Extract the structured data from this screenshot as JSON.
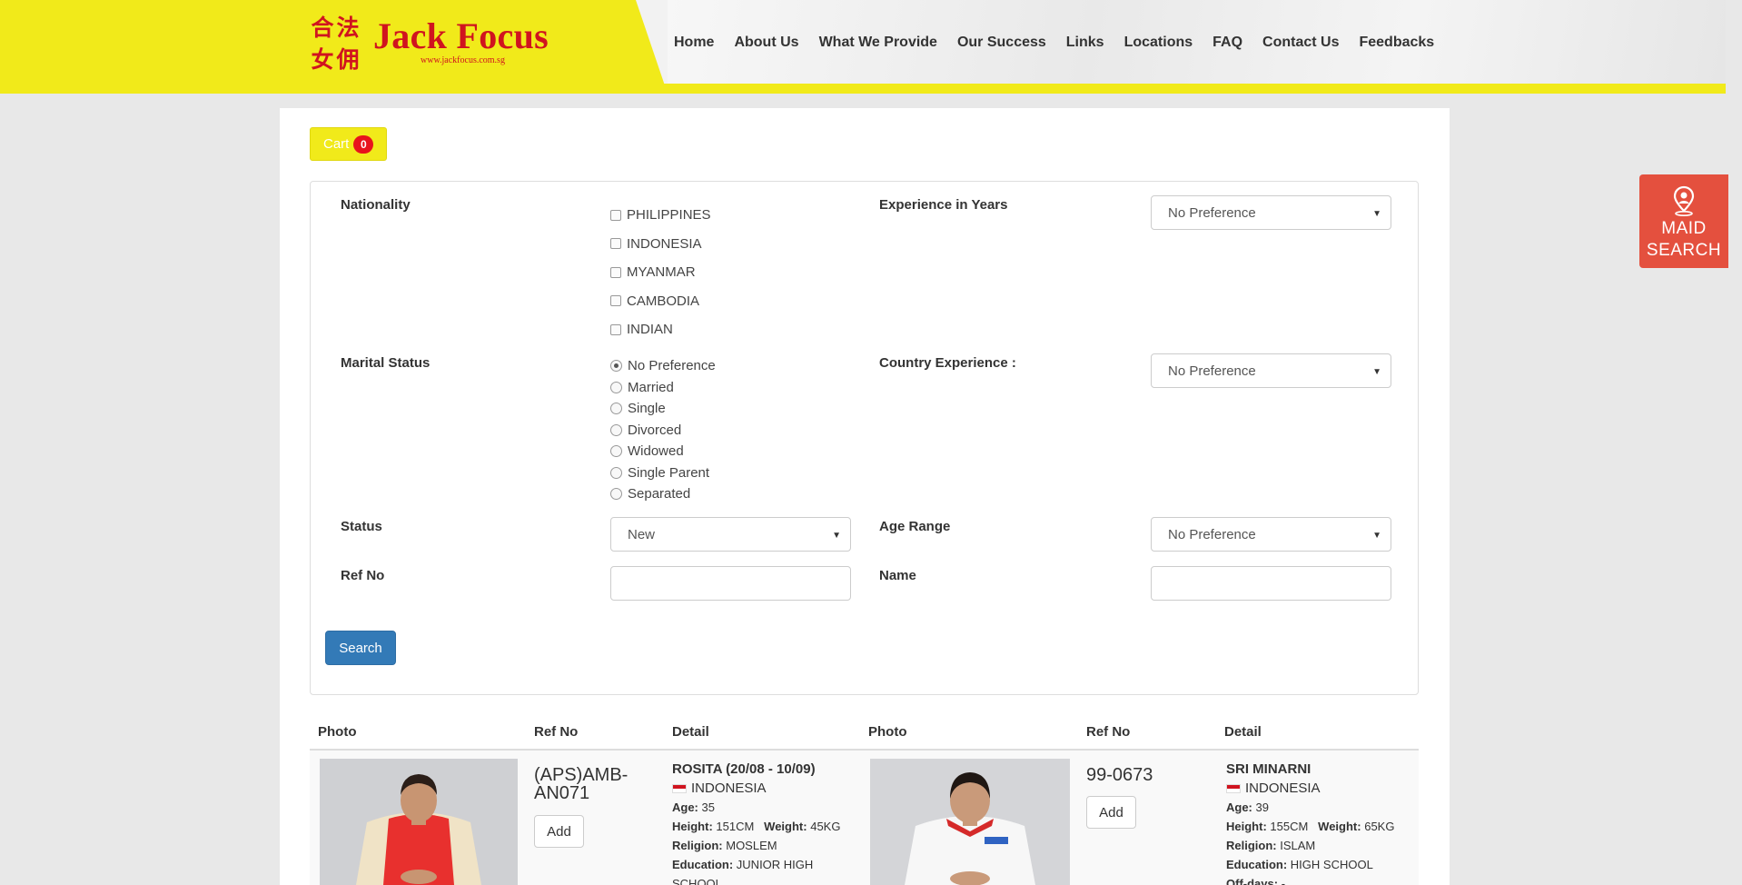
{
  "header": {
    "logo_cjk": [
      "合",
      "法",
      "女",
      "佣"
    ],
    "brand_name": "Jack Focus",
    "brand_url": "www.jackfocus.com.sg",
    "nav": [
      "Home",
      "About Us",
      "What We Provide",
      "Our Success",
      "Links",
      "Locations",
      "FAQ",
      "Contact Us",
      "Feedbacks"
    ]
  },
  "side_tab": {
    "line1": "MAID",
    "line2": "SEARCH"
  },
  "cart": {
    "label": "Cart",
    "count": "0"
  },
  "filters": {
    "nationality_label": "Nationality",
    "nationalities": [
      "PHILIPPINES",
      "INDONESIA",
      "MYANMAR",
      "CAMBODIA",
      "INDIAN"
    ],
    "marital_label": "Marital Status",
    "marital_options": [
      "No Preference",
      "Married",
      "Single",
      "Divorced",
      "Widowed",
      "Single Parent",
      "Separated"
    ],
    "marital_selected": "No Preference",
    "experience_label": "Experience in Years",
    "experience_value": "No Preference",
    "country_exp_label": "Country Experience :",
    "country_exp_value": "No Preference",
    "status_label": "Status",
    "status_value": "New",
    "age_label": "Age Range",
    "age_value": "No Preference",
    "ref_label": "Ref No",
    "ref_value": "",
    "name_label": "Name",
    "name_value": "",
    "search_button": "Search"
  },
  "results": {
    "columns": [
      "Photo",
      "Ref No",
      "Detail",
      "Photo",
      "Ref No",
      "Detail"
    ],
    "add_label": "Add",
    "items": [
      {
        "ref": "(APS)AMB-AN071",
        "name": "ROSITA (20/08 - 10/09)",
        "nationality": "INDONESIA",
        "age_label": "Age:",
        "age": "35",
        "height_label": "Height:",
        "height": "151CM",
        "weight_label": "Weight:",
        "weight": "45KG",
        "religion_label": "Religion:",
        "religion": "MOSLEM",
        "education_label": "Education:",
        "education": "JUNIOR HIGH SCHOOL",
        "uniform_color": "#e8302e"
      },
      {
        "ref": "99-0673",
        "name": "SRI MINARNI",
        "nationality": "INDONESIA",
        "age_label": "Age:",
        "age": "39",
        "height_label": "Height:",
        "height": "155CM",
        "weight_label": "Weight:",
        "weight": "65KG",
        "religion_label": "Religion:",
        "religion": "ISLAM",
        "education_label": "Education:",
        "education": "HIGH SCHOOL",
        "offdays_label": "Off-days:",
        "offdays": "-",
        "uniform_color": "#f5f5f5"
      }
    ]
  },
  "colors": {
    "brand_yellow": "#f1ea1a",
    "brand_red": "#d0141f",
    "button_blue": "#337ab7",
    "side_tab": "#e4503e"
  }
}
